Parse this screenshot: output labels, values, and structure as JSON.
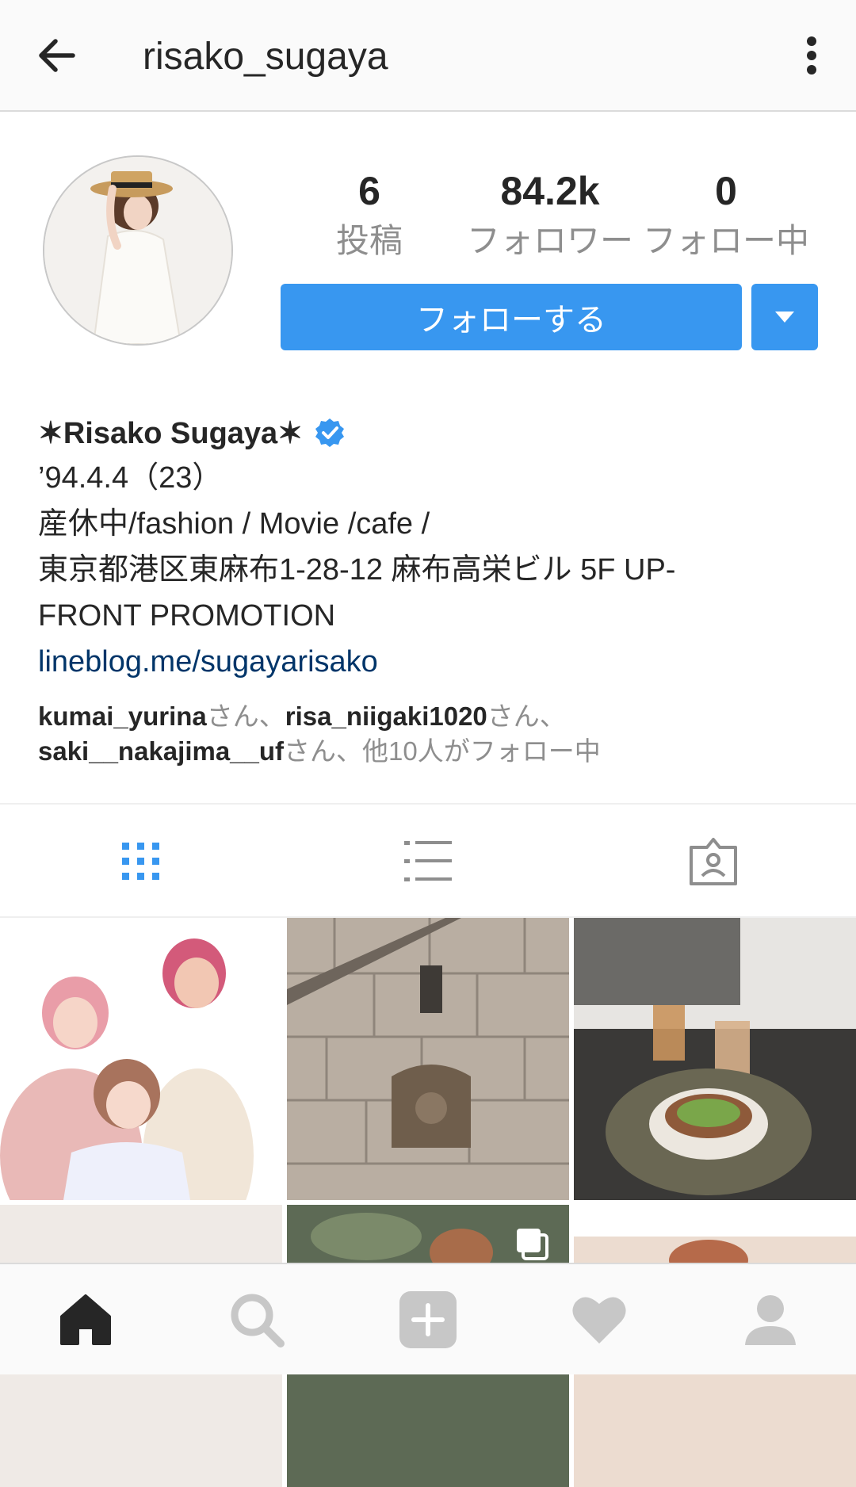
{
  "header": {
    "username": "risako_sugaya",
    "back_icon": "arrow-left-icon",
    "more_icon": "more-vertical-icon"
  },
  "profile": {
    "stats": [
      {
        "value": "6",
        "label": "投稿"
      },
      {
        "value": "84.2k",
        "label": "フォロワー"
      },
      {
        "value": "0",
        "label": "フォロー中"
      }
    ],
    "follow_label": "フォローする",
    "accent_color": "#3897f0"
  },
  "bio": {
    "full_name": "✶Risako Sugaya✶",
    "lines": [
      "’94.4.4（23）",
      "産休中/fashion / Movie /cafe /",
      "東京都港区東麻布1-28-12 麻布高栄ビル 5F UP-",
      "FRONT PROMOTION"
    ],
    "link": "lineblog.me/sugayarisako",
    "followed_by": {
      "user1": "kumai_yurina",
      "sep1": "さん、",
      "user2": "risa_niigaki1020",
      "sep2": "さん、",
      "user3": "saki__nakajima__uf",
      "suffix": "さん、他10人がフォロー中"
    }
  },
  "tabs": [
    {
      "name": "grid-view",
      "icon": "grid-icon",
      "active": true
    },
    {
      "name": "list-view",
      "icon": "list-icon",
      "active": false
    },
    {
      "name": "tagged",
      "icon": "tagged-person-icon",
      "active": false
    }
  ],
  "bottom_nav": [
    {
      "name": "home",
      "icon": "home-icon",
      "active": true
    },
    {
      "name": "search",
      "icon": "search-icon",
      "active": false
    },
    {
      "name": "new-post",
      "icon": "plus-square-icon",
      "active": false
    },
    {
      "name": "activity",
      "icon": "heart-icon",
      "active": false
    },
    {
      "name": "profile",
      "icon": "profile-icon",
      "active": false
    }
  ]
}
